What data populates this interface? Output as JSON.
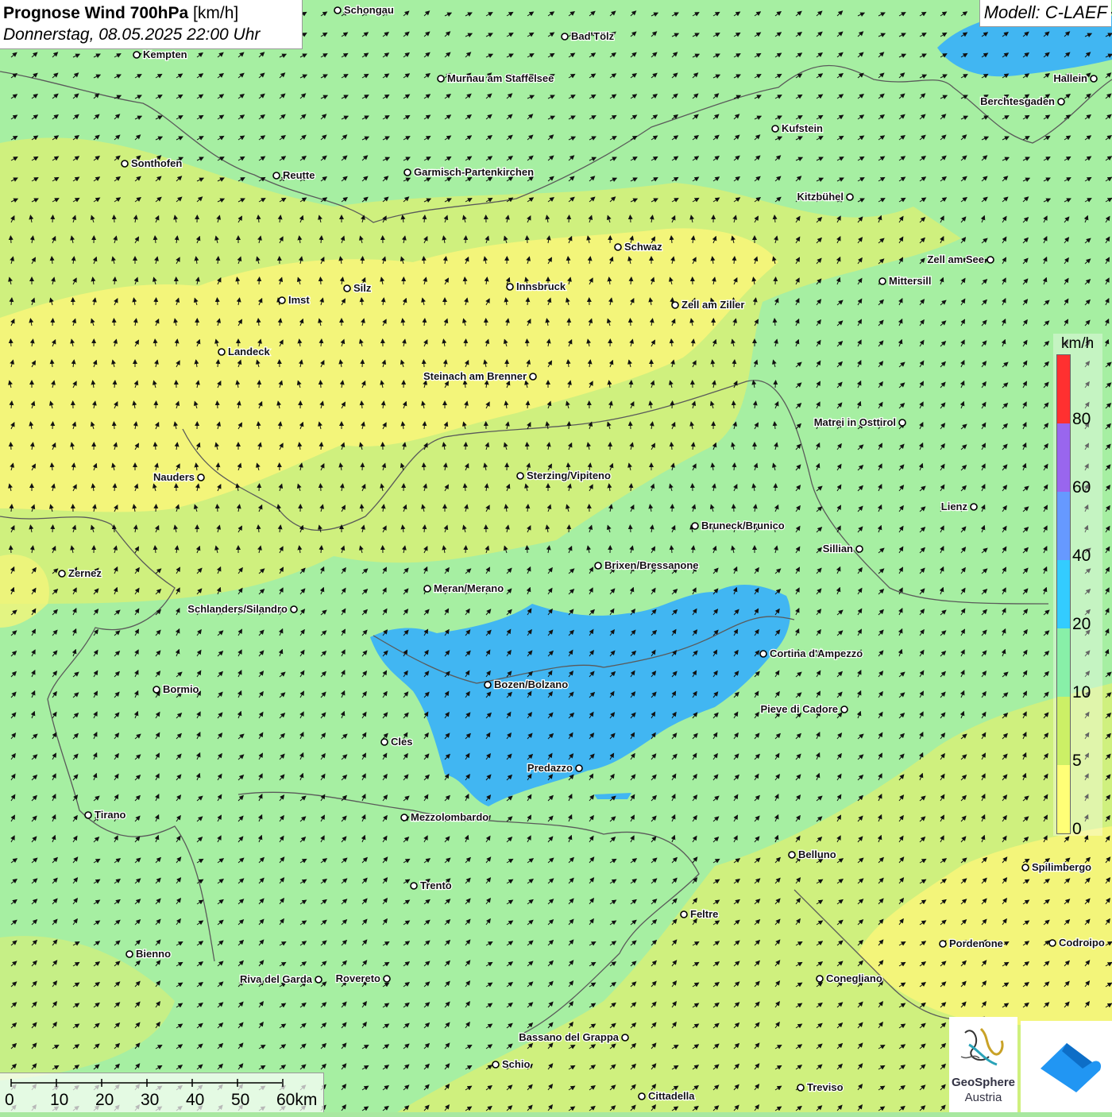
{
  "title": {
    "main": "Prognose Wind 700hPa",
    "unit": "[km/h]",
    "datetime": "Donnerstag, 08.05.2025 22:00 Uhr"
  },
  "model": "Modell: C-LAEF",
  "legend": {
    "unit": "km/h",
    "labels": [
      "80",
      "60",
      "40",
      "20",
      "10",
      "5",
      "0"
    ],
    "colors": [
      "#ff3030",
      "#9966ee",
      "#6699ff",
      "#33ccff",
      "#88f0a8",
      "#ccf066",
      "#ffff77"
    ]
  },
  "scalebar": {
    "labels": [
      "0",
      "10",
      "20",
      "30",
      "40",
      "50",
      "60km"
    ]
  },
  "logo": {
    "name1": "GeoSphere",
    "name2": "Austria"
  },
  "colors": {
    "calm": "#f3f57a",
    "light": "#d4f07a",
    "moderate": "#a6efa2",
    "strong": "#41b6f2"
  },
  "cities": [
    {
      "name": "Schongau",
      "label_side": "right"
    },
    {
      "name": "Bad Tölz",
      "label_side": "right"
    },
    {
      "name": "Kempten",
      "label_side": "right"
    },
    {
      "name": "Murnau am Staffelsee",
      "label_side": "right"
    },
    {
      "name": "Hallein",
      "label_side": "left"
    },
    {
      "name": "Berchtesgaden",
      "label_side": "left"
    },
    {
      "name": "Kufstein",
      "label_side": "right"
    },
    {
      "name": "Sonthofen",
      "label_side": "right"
    },
    {
      "name": "Reutte",
      "label_side": "right"
    },
    {
      "name": "Garmisch-Partenkirchen",
      "label_side": "right"
    },
    {
      "name": "Kitzbühel",
      "label_side": "left"
    },
    {
      "name": "Schwaz",
      "label_side": "right"
    },
    {
      "name": "Zell am See",
      "label_side": "left"
    },
    {
      "name": "Silz",
      "label_side": "right"
    },
    {
      "name": "Innsbruck",
      "label_side": "right"
    },
    {
      "name": "Mittersill",
      "label_side": "right"
    },
    {
      "name": "Imst",
      "label_side": "right"
    },
    {
      "name": "Zell am Ziller",
      "label_side": "right"
    },
    {
      "name": "Landeck",
      "label_side": "right"
    },
    {
      "name": "Steinach am Brenner",
      "label_side": "left"
    },
    {
      "name": "Matrei in Osttirol",
      "label_side": "left"
    },
    {
      "name": "Nauders",
      "label_side": "left"
    },
    {
      "name": "Sterzing/Vipiteno",
      "label_side": "right"
    },
    {
      "name": "Lienz",
      "label_side": "left"
    },
    {
      "name": "Bruneck/Brunico",
      "label_side": "right"
    },
    {
      "name": "Sillian",
      "label_side": "left"
    },
    {
      "name": "Brixen/Bressanone",
      "label_side": "right"
    },
    {
      "name": "Zernez",
      "label_side": "right"
    },
    {
      "name": "Meran/Merano",
      "label_side": "right"
    },
    {
      "name": "Schlanders/Silandro",
      "label_side": "left"
    },
    {
      "name": "Cortina d'Ampezzo",
      "label_side": "right"
    },
    {
      "name": "Bozen/Bolzano",
      "label_side": "right"
    },
    {
      "name": "Bormio",
      "label_side": "right"
    },
    {
      "name": "Pieve di Cadore",
      "label_side": "left"
    },
    {
      "name": "Cles",
      "label_side": "right"
    },
    {
      "name": "Predazzo",
      "label_side": "left"
    },
    {
      "name": "Tirano",
      "label_side": "right"
    },
    {
      "name": "Mezzolombardo",
      "label_side": "right"
    },
    {
      "name": "Belluno",
      "label_side": "right"
    },
    {
      "name": "Spilimbergo",
      "label_side": "right"
    },
    {
      "name": "Trento",
      "label_side": "right"
    },
    {
      "name": "Feltre",
      "label_side": "right"
    },
    {
      "name": "Pordenone",
      "label_side": "right"
    },
    {
      "name": "Codroipo",
      "label_side": "right"
    },
    {
      "name": "Bienno",
      "label_side": "right"
    },
    {
      "name": "Riva del Garda",
      "label_side": "left"
    },
    {
      "name": "Rovereto",
      "label_side": "left"
    },
    {
      "name": "Conegliano",
      "label_side": "right"
    },
    {
      "name": "Bassano del Grappa",
      "label_side": "left"
    },
    {
      "name": "Schio",
      "label_side": "right"
    },
    {
      "name": "Treviso",
      "label_side": "right"
    },
    {
      "name": "Cittadella",
      "label_side": "right"
    }
  ]
}
